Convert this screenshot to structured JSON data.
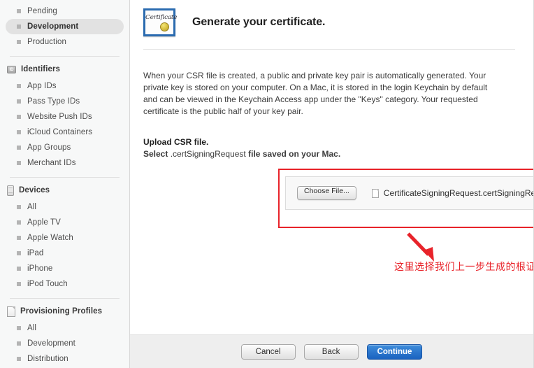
{
  "sidebar": {
    "top_items": [
      {
        "label": "Pending",
        "selected": false
      },
      {
        "label": "Development",
        "selected": true
      },
      {
        "label": "Production",
        "selected": false
      }
    ],
    "sections": [
      {
        "title": "Identifiers",
        "icon": "id-badge-icon",
        "items": [
          {
            "label": "App IDs"
          },
          {
            "label": "Pass Type IDs"
          },
          {
            "label": "Website Push IDs"
          },
          {
            "label": "iCloud Containers"
          },
          {
            "label": "App Groups"
          },
          {
            "label": "Merchant IDs"
          }
        ]
      },
      {
        "title": "Devices",
        "icon": "device-phone-icon",
        "items": [
          {
            "label": "All"
          },
          {
            "label": "Apple TV"
          },
          {
            "label": "Apple Watch"
          },
          {
            "label": "iPad"
          },
          {
            "label": "iPhone"
          },
          {
            "label": "iPod Touch"
          }
        ]
      },
      {
        "title": "Provisioning Profiles",
        "icon": "document-icon",
        "items": [
          {
            "label": "All"
          },
          {
            "label": "Development"
          },
          {
            "label": "Distribution"
          }
        ]
      }
    ]
  },
  "main": {
    "icon_caption": "Certificate",
    "title": "Generate your certificate.",
    "body_paragraph": "When your CSR file is created, a public and private key pair is automatically generated. Your private key is stored on your computer. On a Mac, it is stored in the login Keychain by default and can be viewed in the Keychain Access app under the \"Keys\" category. Your requested certificate is the public half of your key pair.",
    "upload_heading": "Upload CSR file.",
    "upload_sub_prefix": "Select",
    "upload_sub_filetype": ".certSigningRequest",
    "upload_sub_suffix": "file saved on your Mac.",
    "choose_file_label": "Choose File...",
    "selected_file_name": "CertificateSigningRequest.certSigningRequest"
  },
  "annotation": {
    "text": "这里选择我们上一步生成的根证书",
    "color": "#e8232a"
  },
  "footer": {
    "cancel_label": "Cancel",
    "back_label": "Back",
    "continue_label": "Continue",
    "continue_color": "#2b6bb0"
  }
}
